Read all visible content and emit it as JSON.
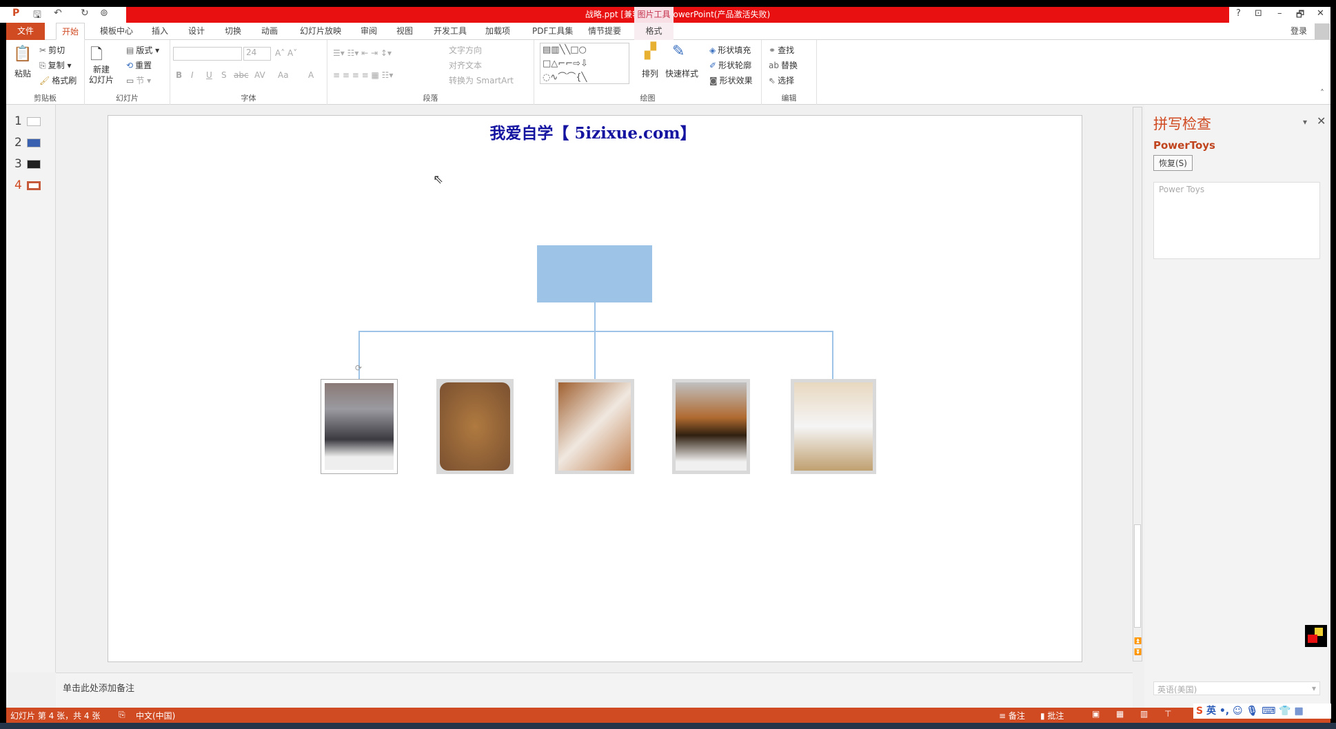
{
  "window": {
    "title": "战略.ppt [兼容模式] - PowerPoint(产品激活失败)",
    "context_tab": "图片工具",
    "signin": "登录",
    "help": "?",
    "restore_ribbon": "⊡",
    "minimize": "–",
    "maximize": "🗗",
    "close": "✕"
  },
  "tabs": [
    "文件",
    "开始",
    "模板中心",
    "插入",
    "设计",
    "切换",
    "动画",
    "幻灯片放映",
    "审阅",
    "视图",
    "开发工具",
    "加载项",
    "PDF工具集",
    "情节提要",
    "格式"
  ],
  "active_tab": "开始",
  "ribbon": {
    "clipboard": {
      "label": "剪贴板",
      "paste": "粘贴",
      "cut": "剪切",
      "copy": "复制",
      "format_painter": "格式刷"
    },
    "slides": {
      "label": "幻灯片",
      "new_slide": "新建\n幻灯片",
      "layout": "版式",
      "reset": "重置",
      "section": "节"
    },
    "font": {
      "label": "字体",
      "font_name": "",
      "font_size": "24",
      "bold": "B",
      "italic": "I",
      "underline": "U",
      "shadow": "S",
      "strike": "abc",
      "spacing": "AV",
      "case": "Aa",
      "color": "A"
    },
    "paragraph": {
      "label": "段落",
      "text_direction": "文字方向",
      "align_text": "对齐文本",
      "convert_smartart": "转换为 SmartArt"
    },
    "drawing": {
      "label": "绘图",
      "arrange": "排列",
      "quick_styles": "快速样式",
      "shape_fill": "形状填充",
      "shape_outline": "形状轮廓",
      "shape_effects": "形状效果"
    },
    "editing": {
      "label": "编辑",
      "find": "查找",
      "replace": "替换",
      "select": "选择"
    }
  },
  "thumbnails": [
    {
      "n": "1"
    },
    {
      "n": "2"
    },
    {
      "n": "3"
    },
    {
      "n": "4",
      "current": true
    }
  ],
  "slide": {
    "title": "我爱自学【 5izixue.com】",
    "pictures": [
      "cat",
      "lion",
      "dog",
      "tiger",
      "crane"
    ]
  },
  "notes": {
    "placeholder": "单击此处添加备注"
  },
  "pane": {
    "title": "拼写检查",
    "word": "PowerToys",
    "resume": "恢复(S)",
    "suggestion": "Power Toys",
    "language": "英语(美国)"
  },
  "status": {
    "slide_info": "幻灯片 第 4 张，共 4 张",
    "language": "中文(中国)",
    "notes": "备注",
    "comments": "批注",
    "ime": "英"
  },
  "colors": {
    "accent": "#d04a22",
    "titlebar": "#e81010",
    "shape": "#9dc3e6"
  }
}
